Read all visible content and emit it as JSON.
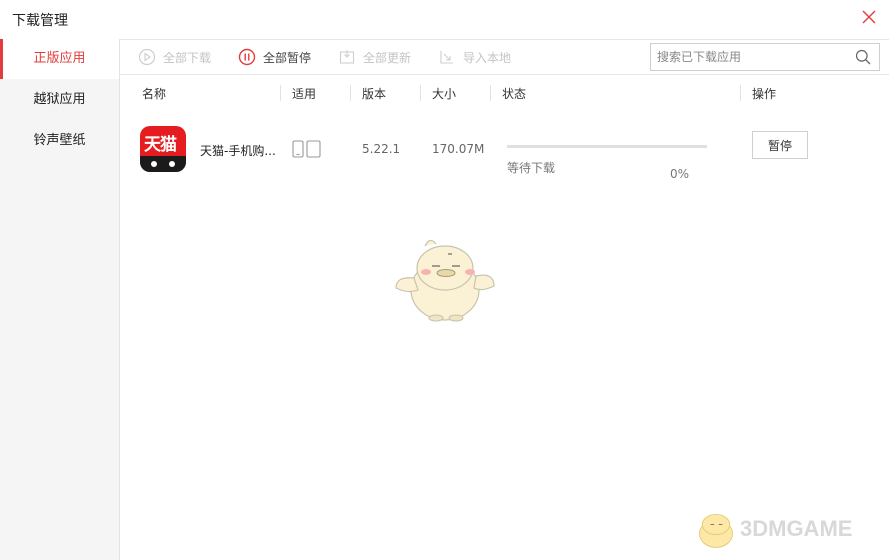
{
  "window": {
    "title": "下载管理"
  },
  "sidebar": {
    "items": [
      {
        "label": "正版应用",
        "active": true
      },
      {
        "label": "越狱应用",
        "active": false
      },
      {
        "label": "铃声壁纸",
        "active": false
      }
    ]
  },
  "toolbar": {
    "download_all": "全部下载",
    "pause_all": "全部暂停",
    "update_all": "全部更新",
    "import_local": "导入本地",
    "search_placeholder": "搜索已下载应用"
  },
  "columns": {
    "name": "名称",
    "compat": "适用",
    "version": "版本",
    "size": "大小",
    "status": "状态",
    "action": "操作"
  },
  "downloads": [
    {
      "app_icon_text": "天猫",
      "name": "天猫-手机购...",
      "version": "5.22.1",
      "size": "170.07M",
      "status": "等待下载",
      "progress_label": "0%",
      "progress": 0,
      "action_label": "暂停"
    }
  ],
  "watermark": {
    "text": "3DMGAME"
  },
  "colors": {
    "accent": "#e23b3b",
    "disabled": "#c4c4c4",
    "sidebar_bg": "#f5f5f5"
  },
  "icons": [
    "close-icon",
    "download-all-icon",
    "pause-all-icon",
    "update-all-icon",
    "import-local-icon",
    "search-icon",
    "phone-icon",
    "tablet-icon",
    "mascot"
  ]
}
